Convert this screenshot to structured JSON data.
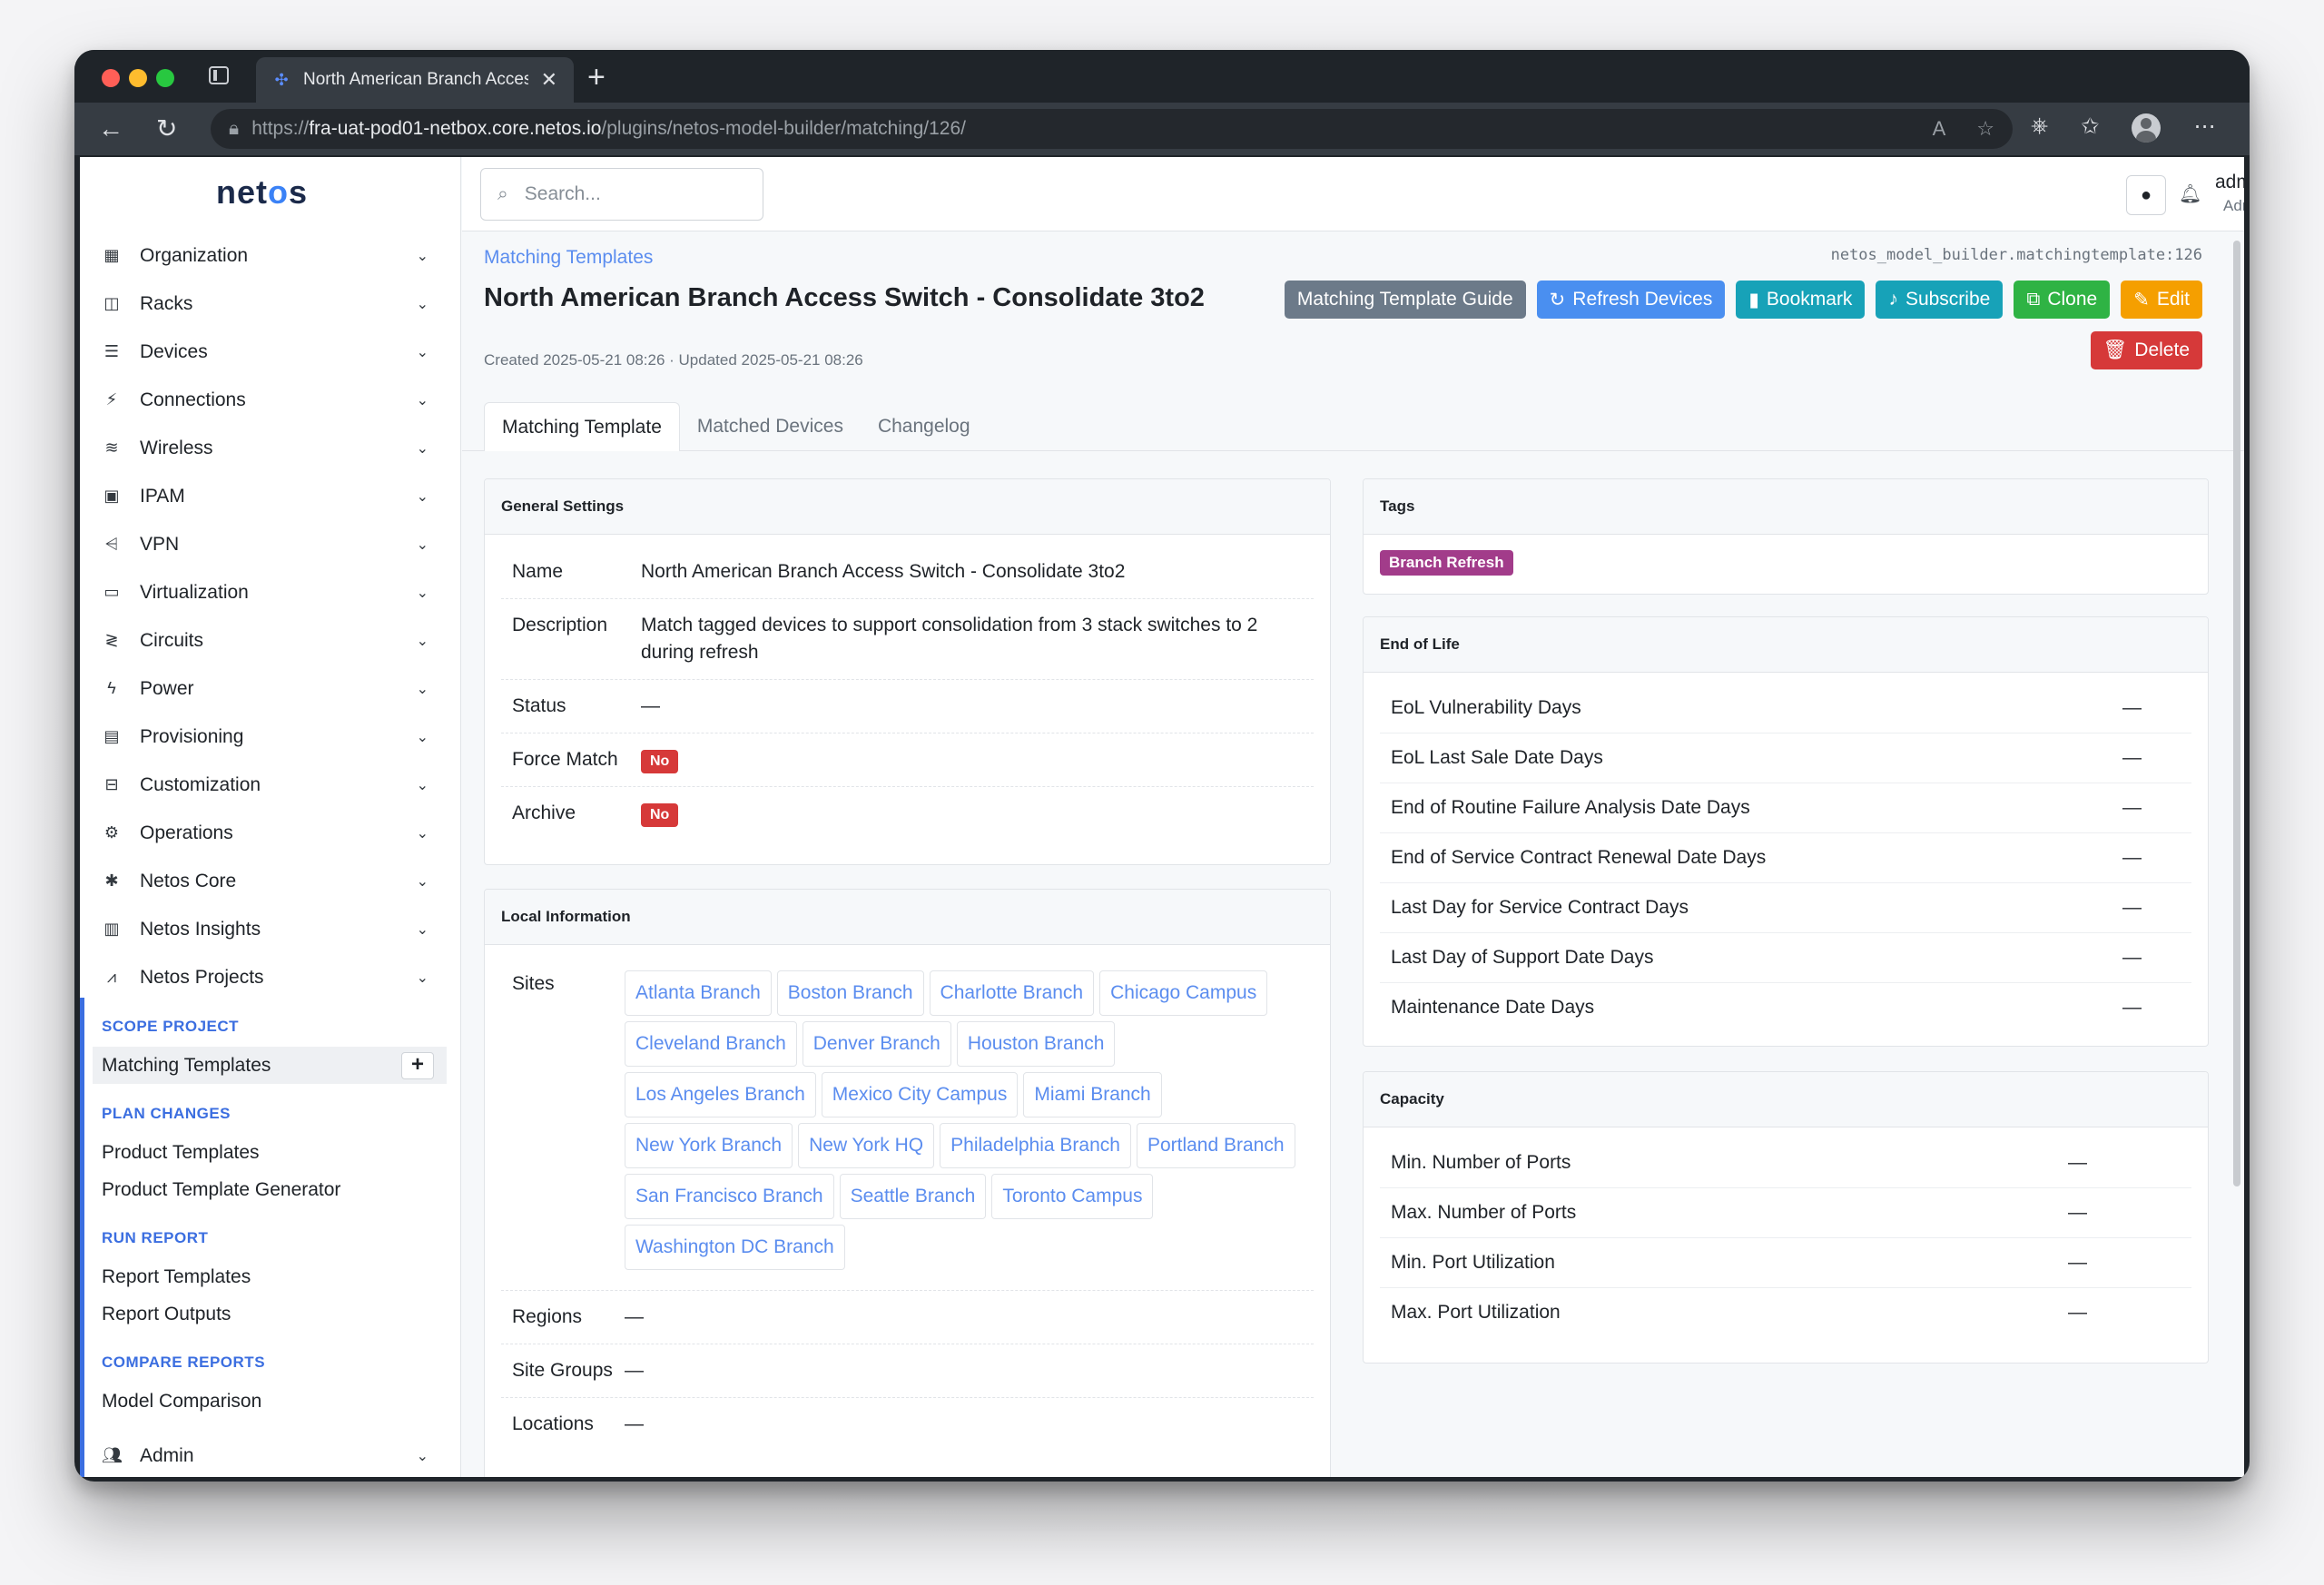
{
  "browser": {
    "tab_title": "North American Branch Access",
    "url_prefix": "https://",
    "url_host": "fra-uat-pod01-netbox.core.netos.io",
    "url_path": "/plugins/netos-model-builder/matching/126/"
  },
  "app": {
    "logo_pre": "net",
    "logo_mid": "o",
    "logo_post": "s"
  },
  "sidebar": {
    "items": [
      {
        "label": "Organization",
        "icon": "building-icon",
        "glyph": "▦"
      },
      {
        "label": "Racks",
        "icon": "rack-icon",
        "glyph": "◫"
      },
      {
        "label": "Devices",
        "icon": "server-icon",
        "glyph": "☰"
      },
      {
        "label": "Connections",
        "icon": "plug-icon",
        "glyph": "⚡"
      },
      {
        "label": "Wireless",
        "icon": "wifi-icon",
        "glyph": "≋"
      },
      {
        "label": "IPAM",
        "icon": "network-card-icon",
        "glyph": "▣"
      },
      {
        "label": "VPN",
        "icon": "tunnel-icon",
        "glyph": "⩤"
      },
      {
        "label": "Virtualization",
        "icon": "monitor-icon",
        "glyph": "▭"
      },
      {
        "label": "Circuits",
        "icon": "circuit-icon",
        "glyph": "≷"
      },
      {
        "label": "Power",
        "icon": "bolt-icon",
        "glyph": "ϟ"
      },
      {
        "label": "Provisioning",
        "icon": "file-icon",
        "glyph": "▤"
      },
      {
        "label": "Customization",
        "icon": "toolbox-icon",
        "glyph": "⊟"
      },
      {
        "label": "Operations",
        "icon": "cogs-icon",
        "glyph": "⚙"
      },
      {
        "label": "Netos Core",
        "icon": "gear-icon",
        "glyph": "✱"
      },
      {
        "label": "Netos Insights",
        "icon": "chart-icon",
        "glyph": "▥"
      },
      {
        "label": "Netos Projects",
        "icon": "chart-line-icon",
        "glyph": "⩘"
      }
    ],
    "sections": [
      {
        "title": "SCOPE PROJECT",
        "links": [
          "Matching Templates"
        ]
      },
      {
        "title": "PLAN CHANGES",
        "links": [
          "Product Templates",
          "Product Template Generator"
        ]
      },
      {
        "title": "RUN REPORT",
        "links": [
          "Report Templates",
          "Report Outputs"
        ]
      },
      {
        "title": "COMPARE REPORTS",
        "links": [
          "Model Comparison"
        ]
      }
    ],
    "admin_label": "Admin"
  },
  "header": {
    "search_placeholder": "Search...",
    "user_name": "admin",
    "user_role": "Admin"
  },
  "page": {
    "breadcrumb": "Matching Templates",
    "object_id": "netos_model_builder.matchingtemplate:126",
    "title": "North American Branch Access Switch - Consolidate 3to2",
    "created": "Created 2025-05-21 08:26 · Updated 2025-05-21 08:26",
    "buttons": {
      "guide": "Matching Template Guide",
      "refresh": "Refresh Devices",
      "bookmark": "Bookmark",
      "subscribe": "Subscribe",
      "clone": "Clone",
      "edit": "Edit",
      "delete": "Delete"
    },
    "tabs": [
      "Matching Template",
      "Matched Devices",
      "Changelog"
    ]
  },
  "general": {
    "header": "General Settings",
    "name_label": "Name",
    "name_value": "North American Branch Access Switch - Consolidate 3to2",
    "desc_label": "Description",
    "desc_value": "Match tagged devices to support consolidation from 3 stack switches to 2 during refresh",
    "status_label": "Status",
    "status_value": "—",
    "force_label": "Force Match",
    "force_value": "No",
    "archive_label": "Archive",
    "archive_value": "No"
  },
  "local": {
    "header": "Local Information",
    "sites_label": "Sites",
    "sites": [
      "Atlanta Branch",
      "Boston Branch",
      "Charlotte Branch",
      "Chicago Campus",
      "Cleveland Branch",
      "Denver Branch",
      "Houston Branch",
      "Los Angeles Branch",
      "Mexico City Campus",
      "Miami Branch",
      "New York Branch",
      "New York HQ",
      "Philadelphia Branch",
      "Portland Branch",
      "San Francisco Branch",
      "Seattle Branch",
      "Toronto Campus",
      "Washington DC Branch"
    ],
    "regions_label": "Regions",
    "regions_value": "—",
    "site_groups_label": "Site Groups",
    "site_groups_value": "—",
    "locations_label": "Locations",
    "locations_value": "—"
  },
  "tags": {
    "header": "Tags",
    "items": [
      "Branch Refresh"
    ],
    "tag_color": "#a23c8a"
  },
  "eol": {
    "header": "End of Life",
    "rows": [
      {
        "label": "EoL Vulnerability Days",
        "value": "—"
      },
      {
        "label": "EoL Last Sale Date Days",
        "value": "—"
      },
      {
        "label": "End of Routine Failure Analysis Date Days",
        "value": "—"
      },
      {
        "label": "End of Service Contract Renewal Date Days",
        "value": "—"
      },
      {
        "label": "Last Day for Service Contract Days",
        "value": "—"
      },
      {
        "label": "Last Day of Support Date Days",
        "value": "—"
      },
      {
        "label": "Maintenance Date Days",
        "value": "—"
      }
    ]
  },
  "capacity": {
    "header": "Capacity",
    "rows": [
      {
        "label": "Min. Number of Ports",
        "value": "—"
      },
      {
        "label": "Max. Number of Ports",
        "value": "—"
      },
      {
        "label": "Min. Port Utilization",
        "value": "—"
      },
      {
        "label": "Max. Port Utilization",
        "value": "—"
      }
    ]
  },
  "colors": {
    "accent": "#3b6ee0",
    "danger": "#d63939",
    "success": "#2fb344",
    "warning": "#f59f00",
    "info": "#17a2b8"
  }
}
